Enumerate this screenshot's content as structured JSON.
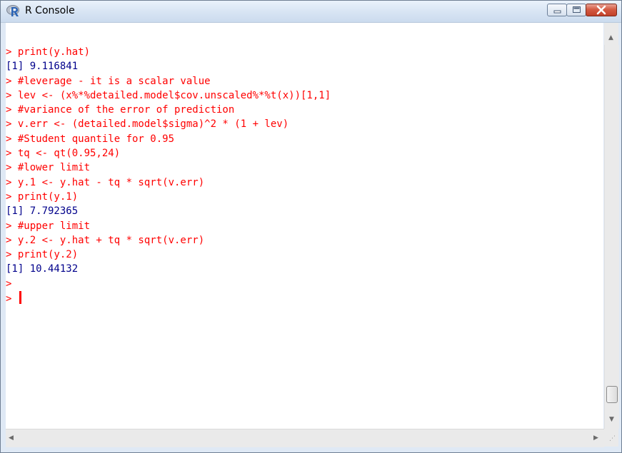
{
  "window": {
    "title": "R Console",
    "icon": "r-logo-icon"
  },
  "console": {
    "lines": [
      {
        "type": "cmd",
        "text": "> print(y.hat)"
      },
      {
        "type": "out",
        "text": "[1] 9.116841"
      },
      {
        "type": "cmd",
        "text": "> #leverage - it is a scalar value"
      },
      {
        "type": "cmd",
        "text": "> lev <- (x%*%detailed.model$cov.unscaled%*%t(x))[1,1]"
      },
      {
        "type": "cmd",
        "text": "> #variance of the error of prediction"
      },
      {
        "type": "cmd",
        "text": "> v.err <- (detailed.model$sigma)^2 * (1 + lev)"
      },
      {
        "type": "cmd",
        "text": "> #Student quantile for 0.95"
      },
      {
        "type": "cmd",
        "text": "> tq <- qt(0.95,24)"
      },
      {
        "type": "cmd",
        "text": "> #lower limit"
      },
      {
        "type": "cmd",
        "text": "> y.1 <- y.hat - tq * sqrt(v.err)"
      },
      {
        "type": "cmd",
        "text": "> print(y.1)"
      },
      {
        "type": "out",
        "text": "[1] 7.792365"
      },
      {
        "type": "cmd",
        "text": "> #upper limit"
      },
      {
        "type": "cmd",
        "text": "> y.2 <- y.hat + tq * sqrt(v.err)"
      },
      {
        "type": "cmd",
        "text": "> print(y.2)"
      },
      {
        "type": "out",
        "text": "[1] 10.44132"
      },
      {
        "type": "cmd",
        "text": ">"
      }
    ],
    "prompt": ">"
  },
  "colors": {
    "command": "#ff0000",
    "output": "#00008b"
  }
}
